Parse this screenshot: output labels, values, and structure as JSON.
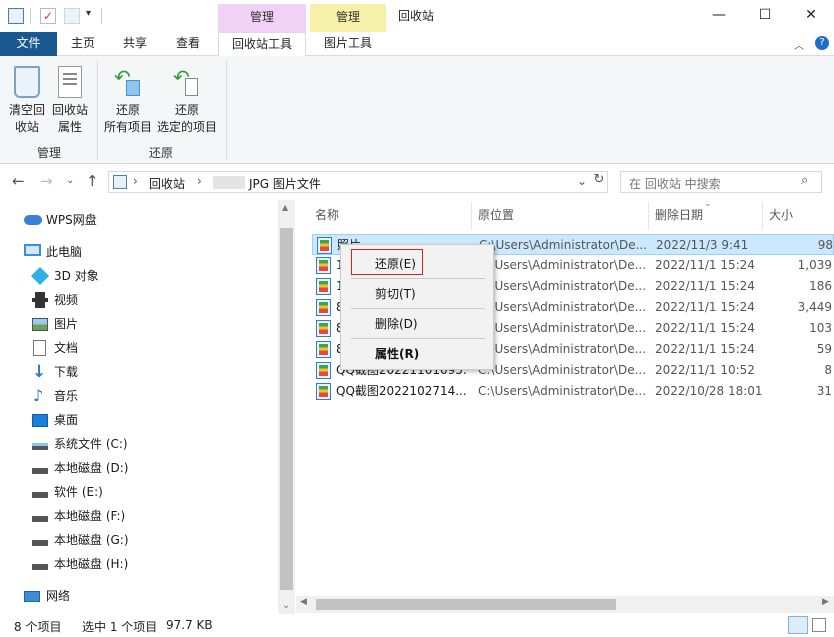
{
  "window": {
    "title": "回收站",
    "context_tab_manage_1": "管理",
    "context_tab_manage_2": "管理",
    "minimize": "—",
    "maximize": "☐",
    "close": "✕"
  },
  "tabs": {
    "file": "文件",
    "home": "主页",
    "share": "共享",
    "view": "查看",
    "recycle_tools": "回收站工具",
    "picture_tools": "图片工具"
  },
  "ribbon": {
    "empty_line1": "清空回",
    "empty_line2": "收站",
    "props_line1": "回收站",
    "props_line2": "属性",
    "restore_all_line1": "还原",
    "restore_all_line2": "所有项目",
    "restore_sel_line1": "还原",
    "restore_sel_line2": "选定的项目",
    "group_manage": "管理",
    "group_restore": "还原"
  },
  "address": {
    "crumb1": "回收站",
    "crumb2": "JPG 图片文件",
    "search_placeholder": "在 回收站 中搜索"
  },
  "sidebar": {
    "items": [
      {
        "label": "WPS网盘",
        "icon": "cloud-icon"
      },
      {
        "label": "此电脑",
        "icon": "computer-icon"
      },
      {
        "label": "3D 对象",
        "icon": "cube-icon"
      },
      {
        "label": "视频",
        "icon": "film-icon"
      },
      {
        "label": "图片",
        "icon": "picture-icon"
      },
      {
        "label": "文档",
        "icon": "document-icon"
      },
      {
        "label": "下载",
        "icon": "download-icon"
      },
      {
        "label": "音乐",
        "icon": "music-icon"
      },
      {
        "label": "桌面",
        "icon": "desktop-icon"
      },
      {
        "label": "系统文件 (C:)",
        "icon": "drive-icon"
      },
      {
        "label": "本地磁盘 (D:)",
        "icon": "drive-icon"
      },
      {
        "label": "软件 (E:)",
        "icon": "drive-icon"
      },
      {
        "label": "本地磁盘 (F:)",
        "icon": "drive-icon"
      },
      {
        "label": "本地磁盘 (G:)",
        "icon": "drive-icon"
      },
      {
        "label": "本地磁盘 (H:)",
        "icon": "drive-icon"
      },
      {
        "label": "网络",
        "icon": "network-icon"
      }
    ]
  },
  "columns": {
    "name": "名称",
    "location": "原位置",
    "deleted": "删除日期",
    "size": "大小"
  },
  "files": [
    {
      "name": "照片",
      "location": "C:\\Users\\Administrator\\De...",
      "deleted": "2022/11/3 9:41",
      "size": "98"
    },
    {
      "name": "1",
      "location": "C:\\Users\\Administrator\\De...",
      "deleted": "2022/11/1 15:24",
      "size": "1,039"
    },
    {
      "name": "1",
      "location": "C:\\Users\\Administrator\\De...",
      "deleted": "2022/11/1 15:24",
      "size": "186"
    },
    {
      "name": "8",
      "location": "C:\\Users\\Administrator\\De...",
      "deleted": "2022/11/1 15:24",
      "size": "3,449"
    },
    {
      "name": "8",
      "location": "C:\\Users\\Administrator\\De...",
      "deleted": "2022/11/1 15:24",
      "size": "103"
    },
    {
      "name": "8",
      "location": "C:\\Users\\Administrator\\De...",
      "deleted": "2022/11/1 15:24",
      "size": "59"
    },
    {
      "name": "QQ截图20221101095...",
      "location": "C:\\Users\\Administrator\\De...",
      "deleted": "2022/11/1 10:52",
      "size": "8"
    },
    {
      "name": "QQ截图2022102714...",
      "location": "C:\\Users\\Administrator\\De...",
      "deleted": "2022/10/28 18:01",
      "size": "31"
    }
  ],
  "context_menu": {
    "restore": "还原(E)",
    "cut": "剪切(T)",
    "delete": "删除(D)",
    "properties": "属性(R)"
  },
  "status": {
    "count": "8 个项目",
    "selected": "选中 1 个项目",
    "size": "97.7 KB"
  },
  "colors": {
    "file_tab": "#19578f",
    "manage_tab_1": "#f1d2f6",
    "manage_tab_2": "#f6f0a8",
    "selection": "#cce8ff",
    "highlight_box": "#d32222"
  }
}
